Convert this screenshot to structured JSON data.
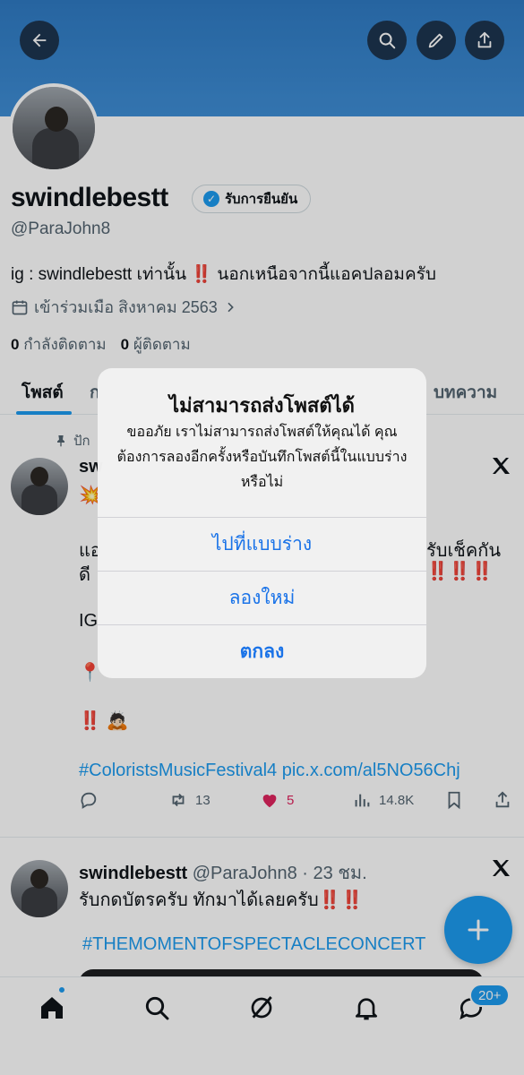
{
  "colors": {
    "accent": "#1d9bf0",
    "banner": "#3f8ed6",
    "like": "#e0245e",
    "alert_button": "#1a73e8"
  },
  "header": {
    "back_icon": "arrow-left-icon",
    "search_icon": "search-icon",
    "edit_icon": "pencil-icon",
    "share_icon": "share-icon"
  },
  "profile": {
    "display_name": "swindlebestt",
    "verify_label": "รับการยืนยัน",
    "handle": "@ParaJohn8",
    "bio": "ig : swindlebestt เท่านั้น ‼️ นอกเหนือจากนี้แอคปลอมครับ",
    "joined": "เข้าร่วมเมือ สิงหาคม 2563",
    "following_count": "0",
    "following_label": "กำลังติดตาม",
    "followers_count": "0",
    "followers_label": "ผู้ติดตาม"
  },
  "tabs": [
    {
      "label": "โพสต์",
      "active": true
    },
    {
      "label": "ก",
      "active": false
    },
    {
      "label": "บทความ",
      "active": false
    }
  ],
  "post1": {
    "pinned_label": "ปัก",
    "author_partial": "sw",
    "emoji_line": "💥",
    "line1_left": "แอ",
    "line1_right": "รับเช็คกัน",
    "line2_left": "ดี",
    "line2_right": "‼️‼️‼️",
    "line3": "IG",
    "pin_emoji": "📍",
    "bangs_line": "‼️ 🙇🏻",
    "hashtag": "#ColoristsMusicFestival4 pic.x.com/al5NO56Chj",
    "retweets": "13",
    "likes": "5",
    "views": "14.8K"
  },
  "post2": {
    "author": "swindlebestt",
    "handle_time": "@ParaJohn8 · 23 ชม.",
    "text": "รับกดบัตรครับ ทักมาได้เลยครับ",
    "bangs": "‼️‼️",
    "hashtag": "#THEMOMENTOFSPECTACLECONCERT"
  },
  "alert": {
    "title": "ไม่สามารถส่งโพสต์ได้",
    "message": "ขออภัย เราไม่สามารถส่งโพสต์ให้คุณได้ คุณต้องการลองอีกครั้งหรือบันทึกโพสต์นี้ในแบบร่างหรือไม่",
    "button_drafts": "ไปที่แบบร่าง",
    "button_retry": "ลองใหม่",
    "button_ok": "ตกลง"
  },
  "bottom_nav": {
    "items": [
      "home-icon",
      "search-icon",
      "grok-icon",
      "bell-icon",
      "messages-icon"
    ],
    "messages_badge": "20+"
  }
}
